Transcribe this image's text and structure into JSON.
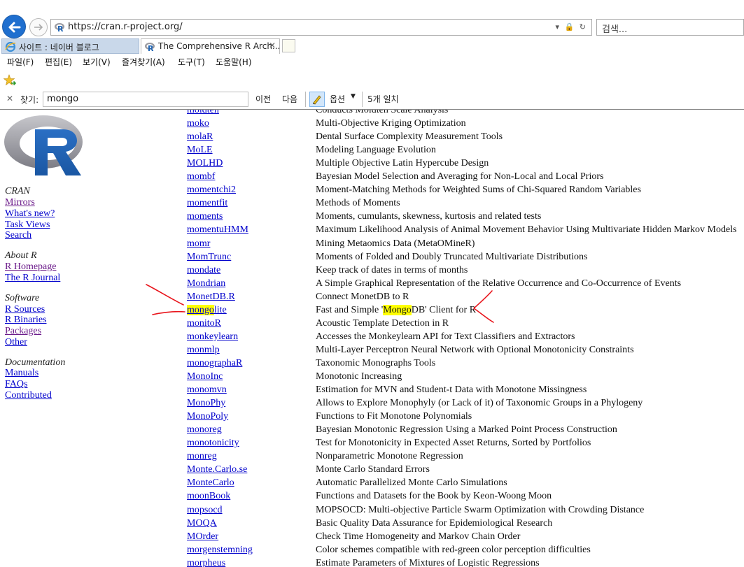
{
  "browser": {
    "url": "https://cran.r-project.org/",
    "search_placeholder": "검색...",
    "tabs": [
      {
        "label": "사이트 : 네이버 블로그"
      },
      {
        "label": "The Comprehensive R Arch..."
      }
    ],
    "menu": [
      "파일(F)",
      "편집(E)",
      "보기(V)",
      "즐겨찾기(A)",
      "도구(T)",
      "도움말(H)"
    ],
    "find": {
      "label": "찾기:",
      "value": "mongo",
      "prev": "이전",
      "next": "다음",
      "options": "옵션",
      "match_count": "5개 일치"
    }
  },
  "sidebar": {
    "cran_heading": "CRAN",
    "cran_links": [
      "Mirrors",
      "What's new?",
      "Task Views",
      "Search"
    ],
    "about_heading": "About R",
    "about_links": [
      "R Homepage",
      "The R Journal"
    ],
    "software_heading": "Software",
    "software_links": [
      "R Sources",
      "R Binaries",
      "Packages",
      "Other"
    ],
    "docs_heading": "Documentation",
    "docs_links": [
      "Manuals",
      "FAQs",
      "Contributed"
    ]
  },
  "packages": [
    {
      "name": "moldten",
      "desc": "Conducts Moldten Scale Analysis"
    },
    {
      "name": "moko",
      "desc": "Multi-Objective Kriging Optimization"
    },
    {
      "name": "molaR",
      "desc": "Dental Surface Complexity Measurement Tools"
    },
    {
      "name": "MoLE",
      "desc": "Modeling Language Evolution"
    },
    {
      "name": "MOLHD",
      "desc": "Multiple Objective Latin Hypercube Design"
    },
    {
      "name": "mombf",
      "desc": "Bayesian Model Selection and Averaging for Non-Local and Local Priors"
    },
    {
      "name": "momentchi2",
      "desc": "Moment-Matching Methods for Weighted Sums of Chi-Squared Random Variables"
    },
    {
      "name": "momentfit",
      "desc": "Methods of Moments"
    },
    {
      "name": "moments",
      "desc": "Moments, cumulants, skewness, kurtosis and related tests"
    },
    {
      "name": "momentuHMM",
      "desc": "Maximum Likelihood Analysis of Animal Movement Behavior Using Multivariate Hidden Markov Models"
    },
    {
      "name": "momr",
      "desc": "Mining Metaomics Data (MetaOMineR)"
    },
    {
      "name": "MomTrunc",
      "desc": "Moments of Folded and Doubly Truncated Multivariate Distributions"
    },
    {
      "name": "mondate",
      "desc": "Keep track of dates in terms of months"
    },
    {
      "name": "Mondrian",
      "desc": "A Simple Graphical Representation of the Relative Occurrence and Co-Occurrence of Events"
    },
    {
      "name": "MonetDB.R",
      "desc": "Connect MonetDB to R"
    },
    {
      "name": "mongolite",
      "name_hl": "mongo",
      "name_rest": "lite",
      "desc": "Fast and Simple 'MongoDB' Client for R",
      "desc_pre": "Fast and Simple '",
      "desc_hl": "Mongo",
      "desc_post": "DB' Client for R"
    },
    {
      "name": "monitoR",
      "desc": "Acoustic Template Detection in R"
    },
    {
      "name": "monkeylearn",
      "desc": "Accesses the Monkeylearn API for Text Classifiers and Extractors"
    },
    {
      "name": "monmlp",
      "desc": "Multi-Layer Perceptron Neural Network with Optional Monotonicity Constraints"
    },
    {
      "name": "monographaR",
      "desc": "Taxonomic Monographs Tools"
    },
    {
      "name": "MonoInc",
      "desc": "Monotonic Increasing"
    },
    {
      "name": "monomvn",
      "desc": "Estimation for MVN and Student-t Data with Monotone Missingness"
    },
    {
      "name": "MonoPhy",
      "desc": "Allows to Explore Monophyly (or Lack of it) of Taxonomic Groups in a Phylogeny"
    },
    {
      "name": "MonoPoly",
      "desc": "Functions to Fit Monotone Polynomials"
    },
    {
      "name": "monoreg",
      "desc": "Bayesian Monotonic Regression Using a Marked Point Process Construction"
    },
    {
      "name": "monotonicity",
      "desc": "Test for Monotonicity in Expected Asset Returns, Sorted by Portfolios"
    },
    {
      "name": "monreg",
      "desc": "Nonparametric Monotone Regression"
    },
    {
      "name": "Monte.Carlo.se",
      "desc": "Monte Carlo Standard Errors"
    },
    {
      "name": "MonteCarlo",
      "desc": "Automatic Parallelized Monte Carlo Simulations"
    },
    {
      "name": "moonBook",
      "desc": "Functions and Datasets for the Book by Keon-Woong Moon"
    },
    {
      "name": "mopsocd",
      "desc": "MOPSOCD: Multi-objective Particle Swarm Optimization with Crowding Distance"
    },
    {
      "name": "MOQA",
      "desc": "Basic Quality Data Assurance for Epidemiological Research"
    },
    {
      "name": "MOrder",
      "desc": "Check Time Homogeneity and Markov Chain Order"
    },
    {
      "name": "morgenstemning",
      "desc": "Color schemes compatible with red-green color perception difficulties"
    },
    {
      "name": "morpheus",
      "desc": "Estimate Parameters of Mixtures of Logistic Regressions"
    }
  ],
  "colors": {
    "link": "#0000cc",
    "visited_link": "#6b1a8a",
    "find_highlight": "#ffff00",
    "annotation_red": "#e8141b"
  },
  "icons": [
    "back-arrow-icon",
    "forward-arrow-icon",
    "r-favicon",
    "lock-icon",
    "refresh-icon",
    "close-icon",
    "favorites-star-icon",
    "highlighter-icon"
  ]
}
